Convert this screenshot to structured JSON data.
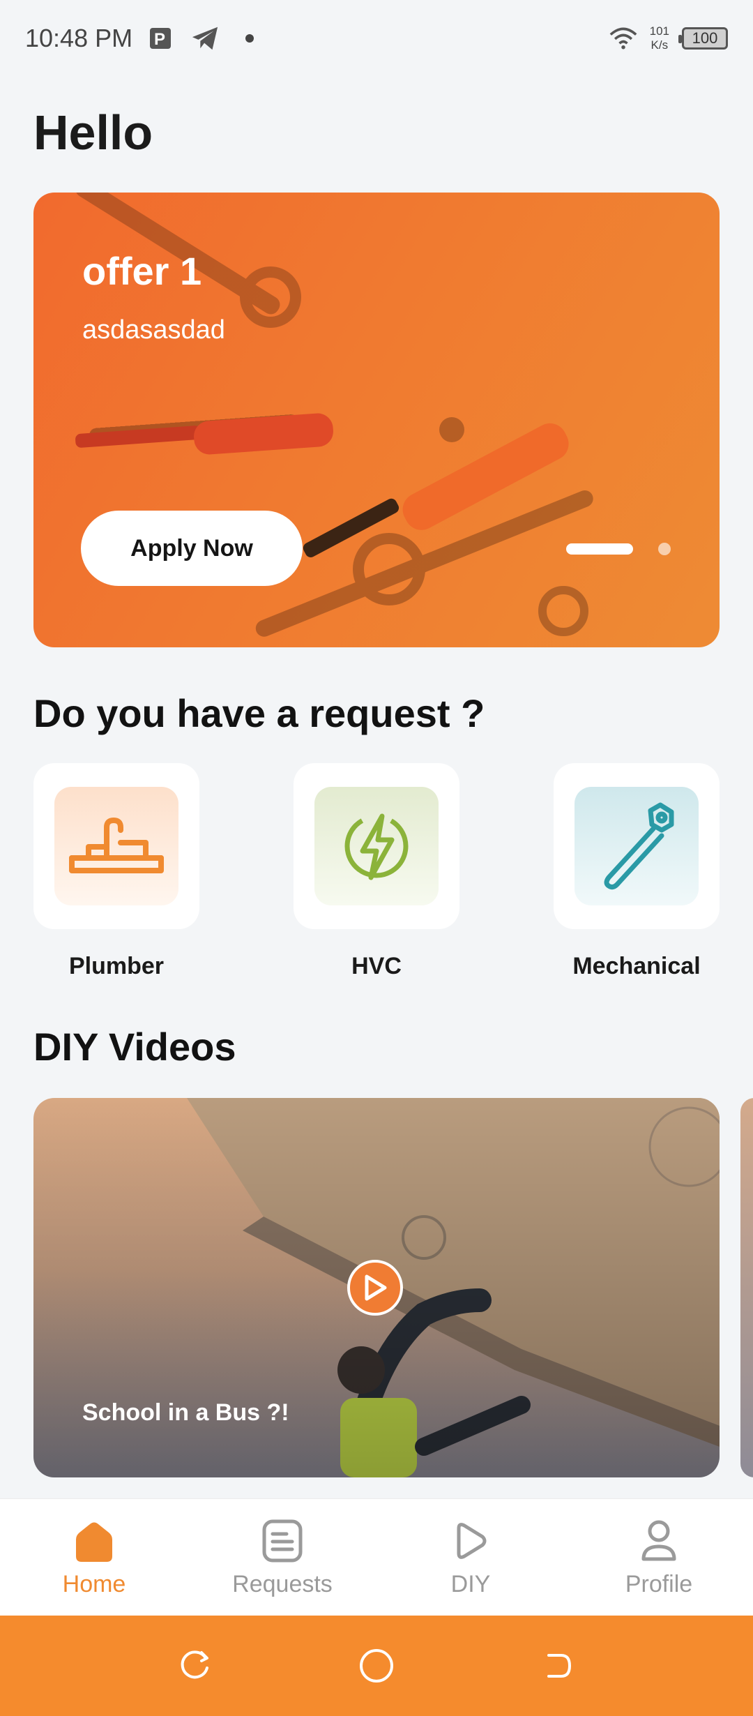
{
  "status_bar": {
    "time": "10:48 PM",
    "net_speed_value": "101",
    "net_speed_unit": "K/s",
    "battery": "100",
    "icons": [
      "parking-icon",
      "telegram-icon",
      "notification-dot",
      "wifi-icon",
      "battery-icon"
    ]
  },
  "greeting": "Hello",
  "offer": {
    "title": "offer 1",
    "subtitle": "asdasasdad",
    "cta_label": "Apply Now",
    "pager": {
      "count": 2,
      "active": 0
    }
  },
  "request_section": {
    "title": "Do you have a request ?",
    "services": [
      {
        "label": "Plumber",
        "icon": "plumbing-icon",
        "color": "#f08a30"
      },
      {
        "label": "HVC",
        "icon": "lightning-icon",
        "color": "#8bb33a"
      },
      {
        "label": "Mechanical",
        "icon": "wrench-icon",
        "color": "#2a9aa6"
      }
    ]
  },
  "diy_section": {
    "title": "DIY Videos",
    "videos": [
      {
        "title": "School in a Bus ?!",
        "icon": "play-icon"
      }
    ]
  },
  "bottom_nav": {
    "items": [
      {
        "label": "Home",
        "icon": "home-icon",
        "active": true
      },
      {
        "label": "Requests",
        "icon": "document-icon",
        "active": false
      },
      {
        "label": "DIY",
        "icon": "play-outline-icon",
        "active": false
      },
      {
        "label": "Profile",
        "icon": "user-icon",
        "active": false
      }
    ]
  },
  "system_nav": {
    "buttons": [
      "recents-icon",
      "home-circle-icon",
      "back-icon"
    ]
  },
  "colors": {
    "accent": "#f08a30",
    "system_bar": "#f58b2d",
    "background": "#f3f5f7"
  }
}
